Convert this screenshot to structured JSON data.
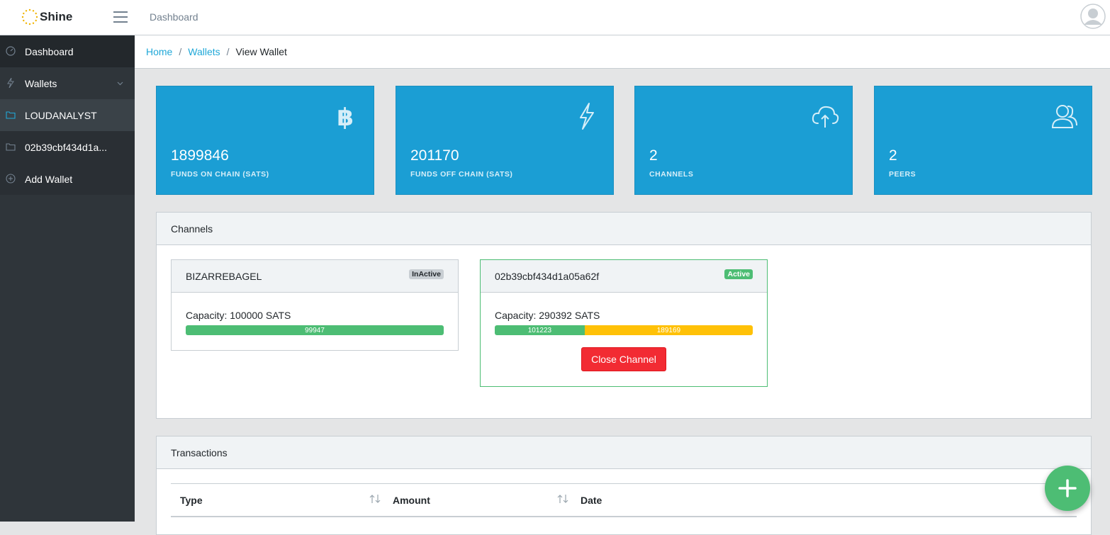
{
  "header": {
    "brand": "Shine",
    "nav_link": "Dashboard"
  },
  "sidebar": {
    "items": [
      {
        "label": "Dashboard",
        "icon": "speedometer-icon"
      },
      {
        "label": "Wallets",
        "icon": "lightning-icon"
      },
      {
        "label": "LOUDANALYST",
        "icon": "folder-icon"
      },
      {
        "label": "02b39cbf434d1a...",
        "icon": "folder-icon"
      },
      {
        "label": "Add Wallet",
        "icon": "plus-circle-icon"
      }
    ]
  },
  "breadcrumb": {
    "home": "Home",
    "wallets": "Wallets",
    "current": "View Wallet",
    "separator": "/"
  },
  "stats": [
    {
      "value": "1899846",
      "label": "FUNDS ON CHAIN (SATS)",
      "icon": "bitcoin-icon"
    },
    {
      "value": "201170",
      "label": "FUNDS OFF CHAIN (SATS)",
      "icon": "lightning-icon"
    },
    {
      "value": "2",
      "label": "CHANNELS",
      "icon": "cloud-upload-icon"
    },
    {
      "value": "2",
      "label": "PEERS",
      "icon": "users-icon"
    }
  ],
  "channels": {
    "title": "Channels",
    "items": [
      {
        "name": "BIZARREBAGEL",
        "status": "InActive",
        "capacity": "Capacity: 100000 SATS",
        "segments": [
          {
            "value": "99947",
            "fraction": 1.0
          }
        ]
      },
      {
        "name": "02b39cbf434d1a05a62f",
        "status": "Active",
        "capacity": "Capacity: 290392 SATS",
        "segments": [
          {
            "value": "101223",
            "fraction": 0.3486
          },
          {
            "value": "189169",
            "fraction": 0.6514
          }
        ],
        "close_label": "Close Channel"
      }
    ]
  },
  "transactions": {
    "title": "Transactions",
    "columns": [
      "Type",
      "Amount",
      "Date"
    ]
  },
  "colors": {
    "accent": "#20a8d8",
    "stat_card": "#1b9ed4",
    "success": "#4dbd74",
    "warning": "#ffc107",
    "danger": "#f22b33",
    "sidebar": "#2f353a"
  }
}
